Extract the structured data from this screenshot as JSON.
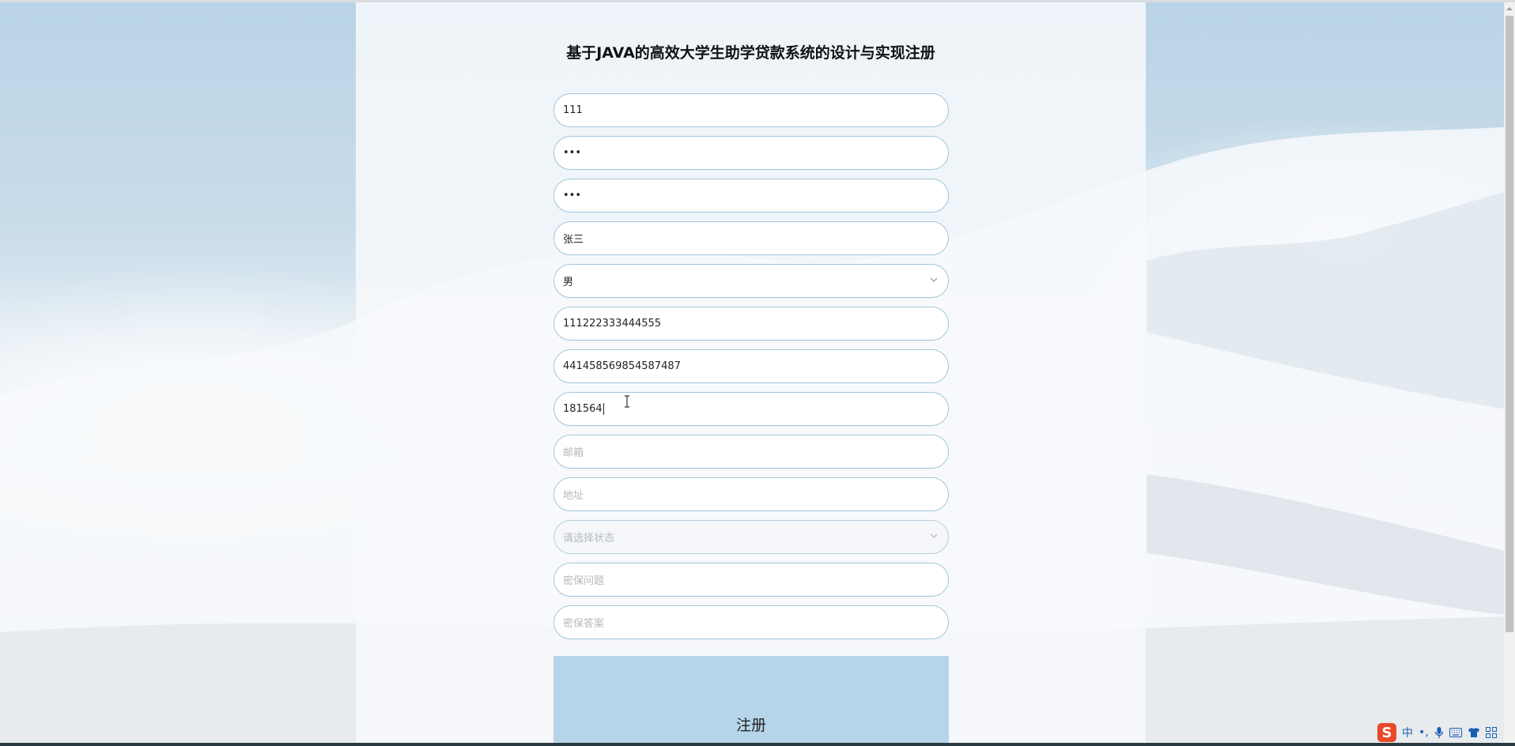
{
  "page": {
    "title": "基于JAVA的高效大学生助学贷款系统的设计与实现注册"
  },
  "form": {
    "fields": [
      {
        "name": "account",
        "value": "111",
        "placeholder": ""
      },
      {
        "name": "password",
        "value": "•••",
        "placeholder": ""
      },
      {
        "name": "confirm-password",
        "value": "•••",
        "placeholder": ""
      },
      {
        "name": "real-name",
        "value": "张三",
        "placeholder": ""
      },
      {
        "name": "gender",
        "value": "男",
        "placeholder": ""
      },
      {
        "name": "student-id",
        "value": "111222333444555",
        "placeholder": ""
      },
      {
        "name": "id-number",
        "value": "441458569854587487",
        "placeholder": ""
      },
      {
        "name": "phone",
        "value": "181564",
        "placeholder": ""
      },
      {
        "name": "email",
        "value": "",
        "placeholder": "邮箱"
      },
      {
        "name": "address",
        "value": "",
        "placeholder": "地址"
      },
      {
        "name": "status",
        "value": "",
        "placeholder": "请选择状态"
      },
      {
        "name": "security-question",
        "value": "",
        "placeholder": "密保问题"
      },
      {
        "name": "security-answer",
        "value": "",
        "placeholder": "密保答案"
      }
    ],
    "submit_label": "注册"
  },
  "ime": {
    "logo": "S",
    "mode": "中",
    "punct": "•,"
  },
  "icons": {
    "dropdown": "chevron-down-icon",
    "text_cursor": "text-cursor-icon",
    "mic": "microphone-icon",
    "keyboard": "keyboard-icon",
    "skin": "shirt-icon",
    "menu": "grid-icon"
  },
  "colors": {
    "field_border": "#9fc6dc",
    "button_bg": "#b6d5ea",
    "placeholder": "#b5b8bd"
  }
}
